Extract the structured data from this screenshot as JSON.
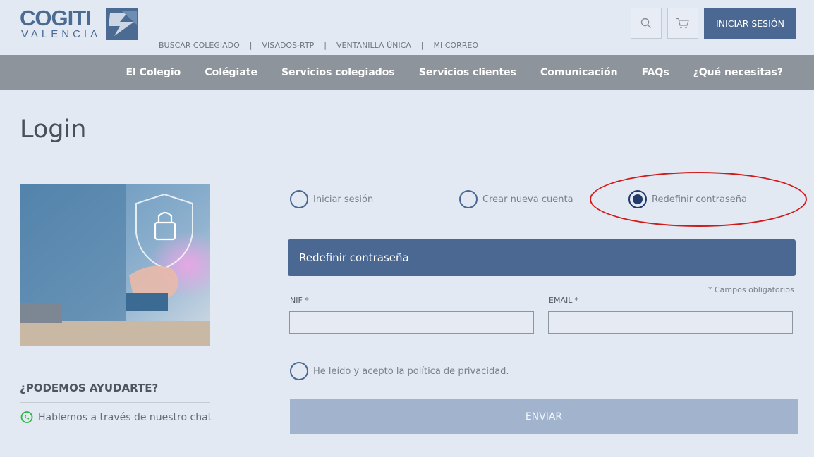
{
  "header": {
    "logo_main": "COGITI",
    "logo_sub": "VALENCIA",
    "top_links": [
      "BUSCAR COLEGIADO",
      "VISADOS-RTP",
      "VENTANILLA ÚNICA",
      "MI CORREO"
    ],
    "link_separator": "|",
    "login_button": "INICIAR SESIÓN",
    "icons": [
      "search-icon",
      "cart-icon"
    ]
  },
  "nav": {
    "items": [
      "El Colegio",
      "Colégiate",
      "Servicios colegiados",
      "Servicios clientes",
      "Comunicación",
      "FAQs",
      "¿Qué necesitas?"
    ]
  },
  "page": {
    "title": "Login"
  },
  "sidebar": {
    "help_title": "¿PODEMOS AYUDARTE?",
    "chat_text": "Hablemos a través de nuestro chat",
    "chat_icon": "whatsapp-icon"
  },
  "form": {
    "options": [
      {
        "label": "Iniciar sesión",
        "selected": false
      },
      {
        "label": "Crear nueva cuenta",
        "selected": false
      },
      {
        "label": "Redefinir contraseña",
        "selected": true
      }
    ],
    "section_title": "Redefinir contraseña",
    "required_note": "* Campos obligatorios",
    "nif_label": "NIF *",
    "nif_value": "",
    "email_label": "EMAIL *",
    "email_value": "",
    "privacy_label": "He leído y acepto la política de privacidad.",
    "submit_label": "ENVIAR"
  },
  "colors": {
    "accent": "#4a6891",
    "nav_bg": "#8e949b",
    "page_bg": "#e3e9f3",
    "highlight": "#d11a1a",
    "submit_bg": "#a2b3cd"
  }
}
